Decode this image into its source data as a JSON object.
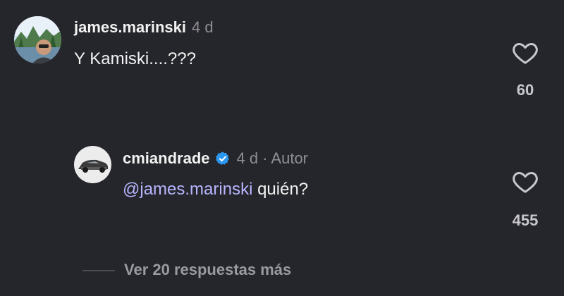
{
  "comments": [
    {
      "username": "james.marinski",
      "meta": "4 d",
      "text": "Y Kamiski....???",
      "likes": "60",
      "avatar_icon": "profile-photo-landscape"
    },
    {
      "username": "cmiandrade",
      "verified": true,
      "meta": "4 d · Autor",
      "mention": "@james.marinski",
      "text": " quién?",
      "likes": "455",
      "avatar_icon": "profile-photo-car"
    }
  ],
  "replies": {
    "label": "Ver 20 respuestas más"
  },
  "colors": {
    "background": "#25262b",
    "mention": "#b7b5ff",
    "verified": "#2b97f0",
    "muted": "#8e8e93"
  },
  "icons": {
    "like": "heart-outline-icon",
    "verified": "verified-badge-icon"
  }
}
